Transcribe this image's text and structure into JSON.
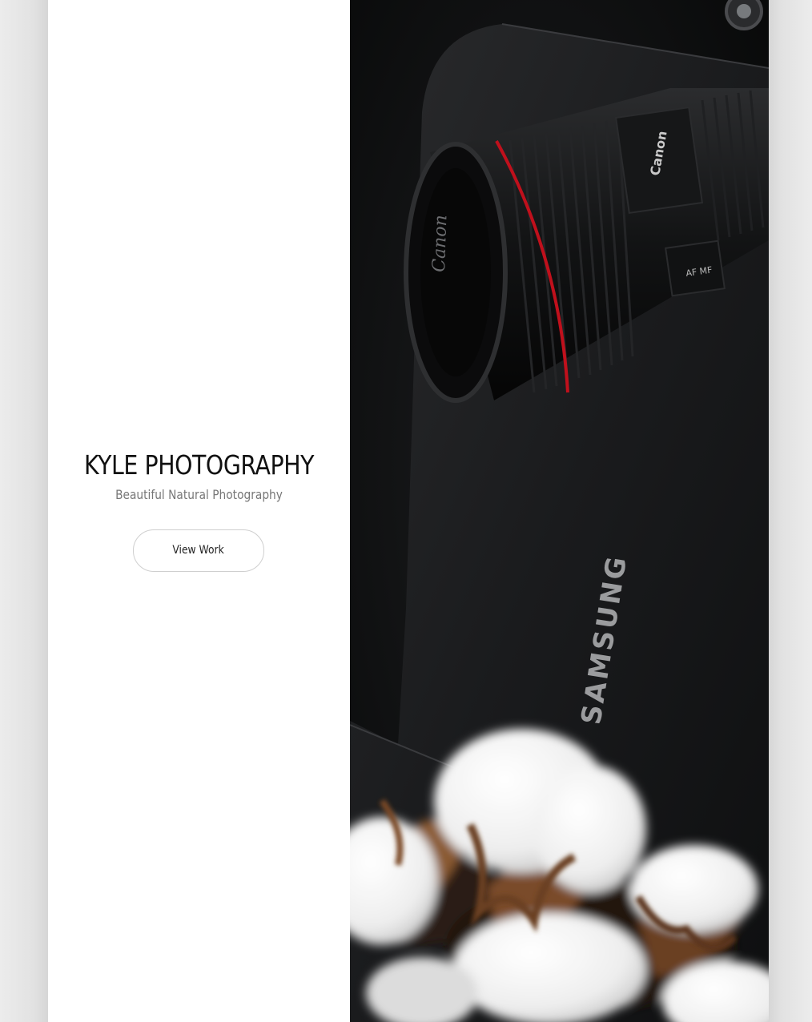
{
  "hero": {
    "title": "KYLE PHOTOGRAPHY",
    "subtitle": "Beautiful Natural Photography",
    "cta_label": "View Work"
  },
  "photo": {
    "subject": "camera-lens-on-laptop-with-cotton",
    "laptop_brand": "SAMSUNG",
    "lens_brand": "Canon",
    "lens_mode_label": "AF  MF"
  },
  "colors": {
    "page_background": "#e9e9e9",
    "panel_background": "#ffffff",
    "title_color": "#111111",
    "subtitle_color": "#777777",
    "button_border": "#cfcfcf",
    "lens_accent_red": "#c0101c"
  }
}
